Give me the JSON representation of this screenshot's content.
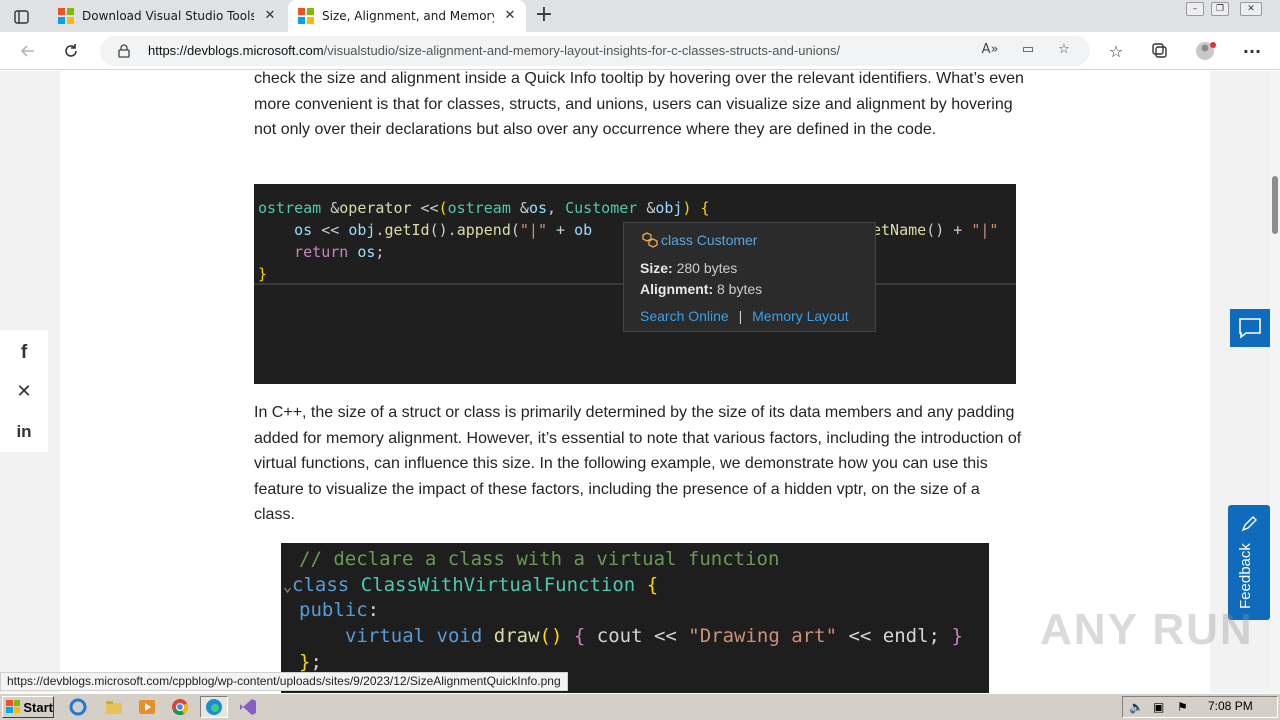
{
  "browser": {
    "tabs": [
      {
        "title": "Download Visual Studio Tools - In",
        "active": false
      },
      {
        "title": "Size, Alignment, and Memory Lay",
        "active": true
      }
    ],
    "url_host": "https://devblogs.microsoft.com",
    "url_path": "/visualstudio/size-alignment-and-memory-layout-insights-for-c-classes-structs-and-unions/",
    "status_url": "https://devblogs.microsoft.com/cppblog/wp-content/uploads/sites/9/2023/12/SizeAlignmentQuickInfo.png"
  },
  "article": {
    "para1": "check the size and alignment inside a Quick Info tooltip by hovering over the relevant identifiers. What’s even more convenient is that for classes, structs, and unions, users can visualize size and alignment by hovering not only over their declarations but also over any occurrence where they are defined in the code.",
    "para2": "In C++, the size of a struct or class is primarily determined by the size of its data members and any padding added for memory alignment. However, it’s essential to note that various factors, including the introduction of virtual functions, can influence this size. In the following example, we demonstrate how you can use this feature to visualize the impact of these factors, including the presence of a hidden vptr, on the size of a class."
  },
  "code1": {
    "tooltip_title": "class Customer",
    "size_label": "Size:",
    "size_value": "280 bytes",
    "align_label": "Alignment:",
    "align_value": "8 bytes",
    "search_link": "Search Online",
    "separator": "|",
    "layout_link": "Memory Layout"
  },
  "code2": {
    "line1": "// declare a class with a virtual function",
    "kw_class": "class",
    "class_name": "ClassWithVirtualFunction",
    "public": "public",
    "kw_virtual": "virtual",
    "kw_void": "void",
    "fn_draw": "draw",
    "kw_cout": "cout",
    "str_drawing": "\"Drawing art\"",
    "kw_endl": "endl"
  },
  "widgets": {
    "feedback_label": "Feedback",
    "watermark": "ANY RUN"
  },
  "taskbar": {
    "start_label": "Start",
    "clock": "7:08 PM"
  }
}
